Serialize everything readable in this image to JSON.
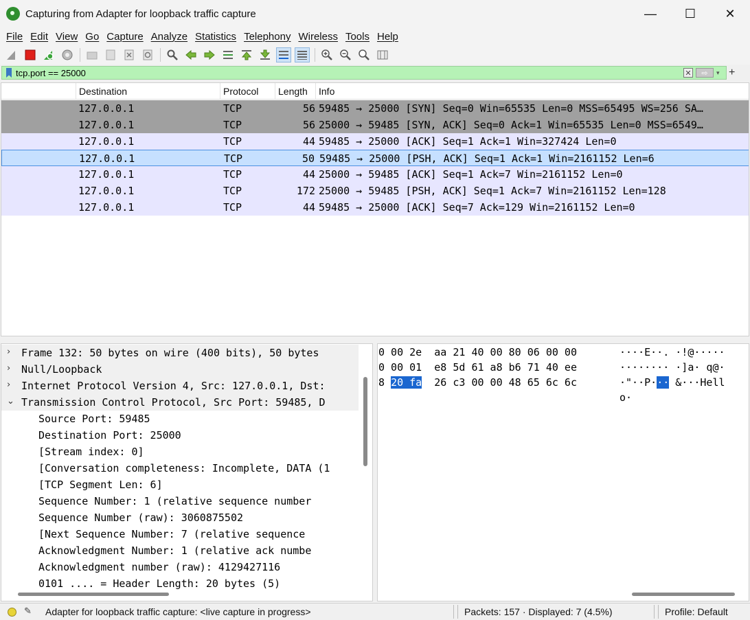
{
  "window": {
    "title": "Capturing from Adapter for loopback traffic capture",
    "controls": {
      "minimize": "—",
      "maximize": "☐",
      "close": "✕"
    }
  },
  "menu": [
    "File",
    "Edit",
    "View",
    "Go",
    "Capture",
    "Analyze",
    "Statistics",
    "Telephony",
    "Wireless",
    "Tools",
    "Help"
  ],
  "toolbar_icons": [
    "shark-fin-icon",
    "stop-icon",
    "restart-icon",
    "options-icon",
    "open-icon",
    "save-icon",
    "close-file-icon",
    "reload-icon",
    "find-icon",
    "back-icon",
    "forward-icon",
    "goto-packet-icon",
    "first-packet-icon",
    "last-packet-icon",
    "autoscroll-icon",
    "colorize-icon",
    "zoom-in-icon",
    "zoom-out-icon",
    "normal-size-icon",
    "resize-columns-icon"
  ],
  "filter": {
    "text": "tcp.port == 25000",
    "clear": "✕",
    "apply": "⇨",
    "dropdown": "▾",
    "add": "+"
  },
  "packet_list": {
    "columns": [
      "Destination",
      "Protocol",
      "Length",
      "Info"
    ],
    "rows": [
      {
        "destination": "127.0.0.1",
        "protocol": "TCP",
        "length": "56",
        "info": "59485 → 25000 [SYN] Seq=0 Win=65535 Len=0 MSS=65495 WS=256 SA…",
        "style": "syn"
      },
      {
        "destination": "127.0.0.1",
        "protocol": "TCP",
        "length": "56",
        "info": "25000 → 59485 [SYN, ACK] Seq=0 Ack=1 Win=65535 Len=0 MSS=6549…",
        "style": "syn"
      },
      {
        "destination": "127.0.0.1",
        "protocol": "TCP",
        "length": "44",
        "info": "59485 → 25000 [ACK] Seq=1 Ack=1 Win=327424 Len=0",
        "style": "norm"
      },
      {
        "destination": "127.0.0.1",
        "protocol": "TCP",
        "length": "50",
        "info": "59485 → 25000 [PSH, ACK] Seq=1 Ack=1 Win=2161152 Len=6",
        "style": "sel"
      },
      {
        "destination": "127.0.0.1",
        "protocol": "TCP",
        "length": "44",
        "info": "25000 → 59485 [ACK] Seq=1 Ack=7 Win=2161152 Len=0",
        "style": "norm"
      },
      {
        "destination": "127.0.0.1",
        "protocol": "TCP",
        "length": "172",
        "info": "25000 → 59485 [PSH, ACK] Seq=1 Ack=7 Win=2161152 Len=128",
        "style": "norm"
      },
      {
        "destination": "127.0.0.1",
        "protocol": "TCP",
        "length": "44",
        "info": "59485 → 25000 [ACK] Seq=7 Ack=129 Win=2161152 Len=0",
        "style": "norm"
      }
    ]
  },
  "details": {
    "items": [
      {
        "arrow": "›",
        "text": "Frame 132: 50 bytes on wire (400 bits), 50 bytes",
        "indent": 0
      },
      {
        "arrow": "›",
        "text": "Null/Loopback",
        "indent": 0
      },
      {
        "arrow": "›",
        "text": "Internet Protocol Version 4, Src: 127.0.0.1, Dst:",
        "indent": 0
      },
      {
        "arrow": "⌄",
        "text": "Transmission Control Protocol, Src Port: 59485, D",
        "indent": 0
      },
      {
        "arrow": "",
        "text": "Source Port: 59485",
        "indent": 1
      },
      {
        "arrow": "",
        "text": "Destination Port: 25000",
        "indent": 1
      },
      {
        "arrow": "",
        "text": "[Stream index: 0]",
        "indent": 1
      },
      {
        "arrow": "",
        "text": "[Conversation completeness: Incomplete, DATA (1",
        "indent": 1
      },
      {
        "arrow": "",
        "text": "[TCP Segment Len: 6]",
        "indent": 1
      },
      {
        "arrow": "",
        "text": "Sequence Number: 1    (relative sequence number",
        "indent": 1
      },
      {
        "arrow": "",
        "text": "Sequence Number (raw): 3060875502",
        "indent": 1
      },
      {
        "arrow": "",
        "text": "[Next Sequence Number: 7    (relative sequence",
        "indent": 1
      },
      {
        "arrow": "",
        "text": "Acknowledgment Number: 1    (relative ack numbe",
        "indent": 1
      },
      {
        "arrow": "",
        "text": "Acknowledgment number (raw): 4129427116",
        "indent": 1
      },
      {
        "arrow": "",
        "text": "0101 .... = Header Length: 20 bytes (5)",
        "indent": 1
      }
    ]
  },
  "bytes": {
    "rows": [
      {
        "hex_pre": "0 00 2e  aa 21 40 00 80 06 00 00",
        "hl": "",
        "hex_post": "",
        "ascii_pre": "····E··. ·!@·····",
        "ascii_hl": "",
        "ascii_post": ""
      },
      {
        "hex_pre": "0 00 01  e8 5d 61 a8 b6 71 40 ee",
        "hl": "",
        "hex_post": "",
        "ascii_pre": "········ ·]a· q@·",
        "ascii_hl": "",
        "ascii_post": ""
      },
      {
        "hex_pre": "8 ",
        "hl": "20 fa",
        "hex_post": "  26 c3 00 00 48 65 6c 6c",
        "ascii_pre": "·\"··P·",
        "ascii_hl": "··",
        "ascii_post": " &···Hell"
      },
      {
        "hex_pre": "",
        "hl": "",
        "hex_post": "",
        "ascii_pre": "o·",
        "ascii_hl": "",
        "ascii_post": ""
      }
    ]
  },
  "status": {
    "message": "Adapter for loopback traffic capture: <live capture in progress>",
    "packets": "Packets: 157 · Displayed: 7 (4.5%)",
    "profile": "Profile: Default"
  }
}
